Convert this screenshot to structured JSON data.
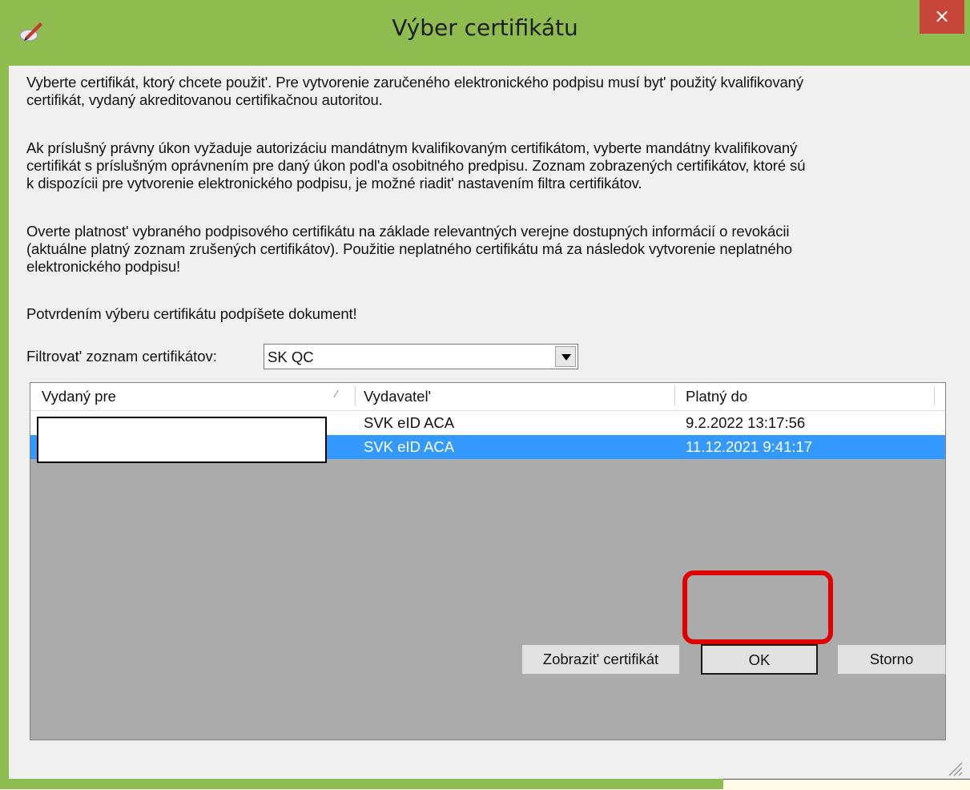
{
  "window": {
    "title": "Výber certifikátu",
    "close_glyph": "×",
    "icon": "pen-sign-icon"
  },
  "intro": {
    "p1_line1": "Vyberte certifikát, ktorý chcete použit'. Pre vytvorenie zaručeného elektronického podpisu musí byt' použitý kvalifikovaný",
    "p1_line2": "certifikát, vydaný akreditovanou certifikačnou autoritou.",
    "p2_line1": "Ak príslušný právny úkon vyžaduje autorizáciu mandátnym kvalifikovaným certifikátom, vyberte mandátny kvalifikovaný",
    "p2_line2": "certifikát s príslušným oprávnením pre daný úkon podl'a osobitného predpisu. Zoznam zobrazených certifikátov, ktoré sú",
    "p2_line3": "k dispozícii pre vytvorenie elektronického podpisu, je možné riadit' nastavením filtra certifikátov.",
    "p3_line1": "Overte platnost' vybraného podpisového certifikátu na základe relevantných verejne dostupných informácií o revokácii",
    "p3_line2": "(aktuálne platný zoznam zrušených certifikátov). Použitie neplatného certifikátu má za následok vytvorenie neplatného",
    "p3_line3": "elektronického podpisu!",
    "p4": "Potvrdením výberu certifikátu podpíšete dokument!"
  },
  "filter": {
    "label": "Filtrovat' zoznam certifikátov:",
    "value": "SK QC"
  },
  "list": {
    "columns": [
      "Vydaný pre",
      "Vydavatel'",
      "Platný do"
    ],
    "sort_glyph": "⁄",
    "rows": [
      {
        "issued_for": "",
        "issuer": "SVK eID ACA",
        "valid_to": "9.2.2022 13:17:56",
        "selected": false
      },
      {
        "issued_for": "",
        "issuer": "SVK eID ACA",
        "valid_to": "11.12.2021 9:41:17",
        "selected": true
      }
    ]
  },
  "buttons": {
    "view": "Zobrazit' certifikát",
    "ok": "OK",
    "cancel": "Storno"
  },
  "colors": {
    "titlebar": "#8fbc4e",
    "close": "#c7463a",
    "selection": "#3399ff",
    "highlight": "#e00000"
  }
}
